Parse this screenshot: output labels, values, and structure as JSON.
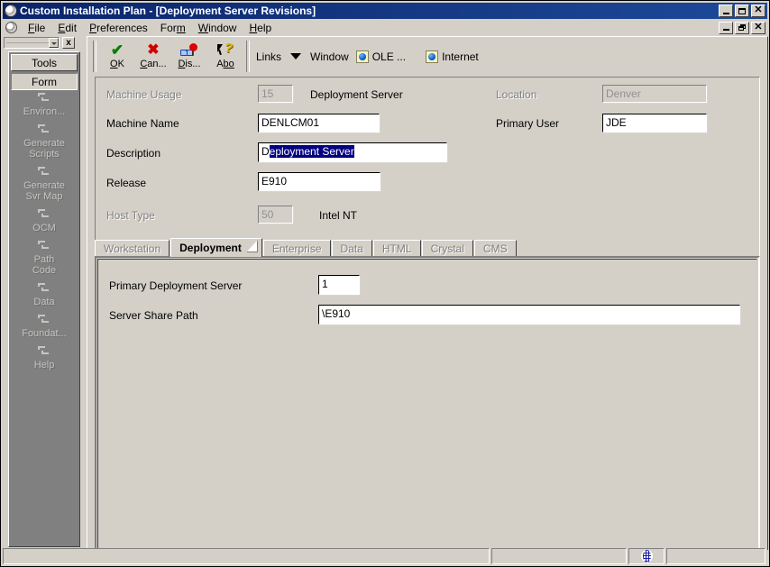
{
  "window": {
    "title": "Custom Installation Plan - [Deployment Server Revisions]",
    "logo_icon": "globe-logo-icon",
    "buttons": {
      "minimize": "minimize-button",
      "maximize": "maximize-button",
      "close": "close-button",
      "child_minimize": "child-minimize-button",
      "child_restore": "child-restore-button",
      "child_close": "child-close-button"
    }
  },
  "menu": {
    "items": [
      {
        "label": "File",
        "accel": "F"
      },
      {
        "label": "Edit",
        "accel": "E"
      },
      {
        "label": "Preferences",
        "accel": "P"
      },
      {
        "label": "Form",
        "accel": "m"
      },
      {
        "label": "Window",
        "accel": "W"
      },
      {
        "label": "Help",
        "accel": "H"
      }
    ]
  },
  "dock": {
    "combo_value": "",
    "close_label": "x",
    "tabs": [
      {
        "label": "Tools",
        "active": false
      },
      {
        "label": "Form",
        "active": true
      }
    ],
    "items": [
      {
        "label": "Environ...",
        "icon": "form-shortcut-icon"
      },
      {
        "label": "Generate\nScripts",
        "icon": "form-shortcut-icon"
      },
      {
        "label": "Generate\nSvr Map",
        "icon": "form-shortcut-icon"
      },
      {
        "label": "OCM",
        "icon": "form-shortcut-icon"
      },
      {
        "label": "Path\nCode",
        "icon": "form-shortcut-icon"
      },
      {
        "label": "Data",
        "icon": "form-shortcut-icon"
      },
      {
        "label": "Foundat...",
        "icon": "form-shortcut-icon"
      },
      {
        "label": "Help",
        "icon": "form-shortcut-icon"
      }
    ]
  },
  "toolbar": {
    "buttons": [
      {
        "label": "OK",
        "accel": "O",
        "rest": "K",
        "icon": "green-check-icon"
      },
      {
        "label": "Can...",
        "accel": "C",
        "rest": "an...",
        "icon": "red-x-icon"
      },
      {
        "label": "Dis...",
        "accel": "D",
        "rest": "is...",
        "icon": "display-errors-icon"
      },
      {
        "label": "Abo",
        "accel": "bo",
        "rest": "A",
        "icon": "about-help-arrow-icon"
      }
    ],
    "links_label": "Links",
    "window_label": "Window",
    "window_arrow_icon": "chevron-down-icon",
    "ole_label": "OLE ...",
    "ole_icon": "ole-globe-doc-icon",
    "internet_label": "Internet",
    "internet_icon": "internet-globe-doc-icon"
  },
  "header_fields": {
    "machine_usage": {
      "label": "Machine Usage",
      "value": "15",
      "description": "Deployment Server",
      "disabled": true
    },
    "machine_name": {
      "label": "Machine Name",
      "value": "DENLCM01",
      "disabled": false
    },
    "description": {
      "label": "Description",
      "value": "Deployment Server",
      "selected_text": "eployment Server",
      "lead_char": "D",
      "disabled": false
    },
    "release": {
      "label": "Release",
      "value": "E910",
      "disabled": false
    },
    "host_type": {
      "label": "Host Type",
      "value": "50",
      "description": "Intel NT",
      "disabled": true
    },
    "location": {
      "label": "Location",
      "value": "Denver",
      "disabled": true
    },
    "primary_user": {
      "label": "Primary User",
      "value": "JDE",
      "disabled": false
    }
  },
  "tabs": [
    {
      "label": "Workstation",
      "active": false
    },
    {
      "label": "Deployment",
      "active": true
    },
    {
      "label": "Enterprise",
      "active": false
    },
    {
      "label": "Data",
      "active": false
    },
    {
      "label": "HTML",
      "active": false
    },
    {
      "label": "Crystal",
      "active": false
    },
    {
      "label": "CMS",
      "active": false
    }
  ],
  "tabpage": {
    "primary_deployment_server": {
      "label": "Primary Deployment Server",
      "value": "1"
    },
    "server_share_path": {
      "label": "Server Share Path",
      "value": "\\E910"
    }
  },
  "statusbar": {
    "main": "",
    "mid": "",
    "right": "",
    "icon": "globe-status-icon"
  },
  "colors": {
    "face": "#d4d0c8",
    "titlebar": "#0a246a",
    "selection": "#000080",
    "dock_bg": "#808080",
    "ok_green": "#008000",
    "cancel_red": "#d00000"
  }
}
